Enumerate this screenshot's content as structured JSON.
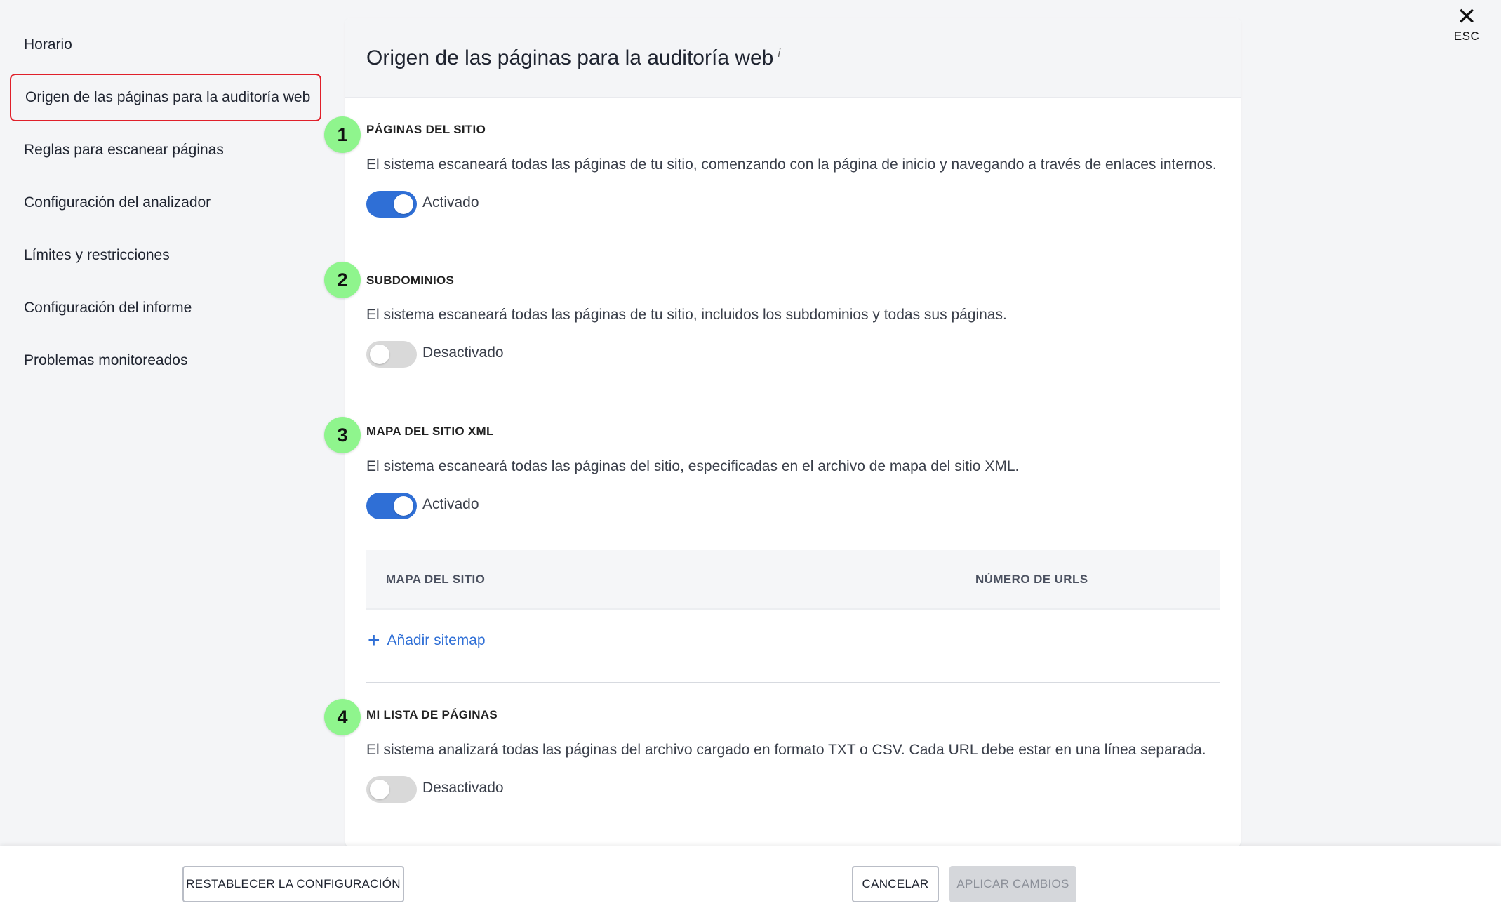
{
  "sidebar": {
    "items": [
      {
        "label": "Horario"
      },
      {
        "label": "Origen de las páginas para la auditoría web"
      },
      {
        "label": "Reglas para escanear páginas"
      },
      {
        "label": "Configuración del analizador"
      },
      {
        "label": "Límites y restricciones"
      },
      {
        "label": "Configuración del informe"
      },
      {
        "label": "Problemas monitoreados"
      }
    ],
    "active_index": 1,
    "active_border_color": "#e0202a"
  },
  "close": {
    "label": "ESC",
    "icon": "close-icon"
  },
  "card": {
    "title": "Origen de las páginas para la auditoría web",
    "info_glyph": "i",
    "sections": [
      {
        "badge": "1",
        "title": "PÁGINAS DEL SITIO",
        "description": "El sistema escaneará todas las páginas de tu sitio, comenzando con la página de inicio y navegando a través de enlaces internos.",
        "toggle_state": "on",
        "toggle_label": "Activado"
      },
      {
        "badge": "2",
        "title": "SUBDOMINIOS",
        "description": "El sistema escaneará todas las páginas de tu sitio, incluidos los subdominios y todas sus páginas.",
        "toggle_state": "off",
        "toggle_label": "Desactivado"
      },
      {
        "badge": "3",
        "title": "MAPA DEL SITIO XML",
        "description": "El sistema escaneará todas las páginas del sitio, especificadas en el archivo de mapa del sitio XML.",
        "toggle_state": "on",
        "toggle_label": "Activado",
        "table": {
          "columns": [
            "MAPA DEL SITIO",
            "NÚMERO DE URLS"
          ]
        },
        "add_link": {
          "icon": "plus-icon",
          "label": "Añadir sitemap"
        }
      },
      {
        "badge": "4",
        "title": "MI LISTA DE PÁGINAS",
        "description": "El sistema analizará todas las páginas del archivo cargado en formato TXT o CSV. Cada URL debe estar en una línea separada.",
        "toggle_state": "off",
        "toggle_label": "Desactivado"
      }
    ]
  },
  "footer": {
    "reset_label": "RESTABLECER LA CONFIGURACIÓN",
    "cancel_label": "CANCELAR",
    "apply_label": "APLICAR CAMBIOS"
  },
  "colors": {
    "accent": "#2f6fd6",
    "badge": "#8ff58d",
    "toggle_off": "#d9d9d9"
  }
}
